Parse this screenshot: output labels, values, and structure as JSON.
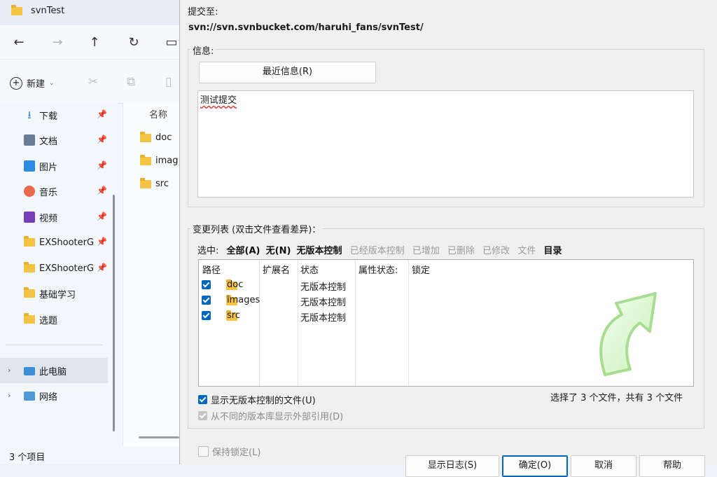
{
  "explorer": {
    "window_title": "svnTest",
    "toolbar": {
      "new_label": "新建"
    },
    "sidebar": [
      {
        "label": "下载",
        "icon": "download-icon",
        "pinned": true
      },
      {
        "label": "文档",
        "icon": "document-icon",
        "pinned": true
      },
      {
        "label": "图片",
        "icon": "pictures-icon",
        "pinned": true
      },
      {
        "label": "音乐",
        "icon": "music-icon",
        "pinned": true
      },
      {
        "label": "视频",
        "icon": "video-icon",
        "pinned": true
      },
      {
        "label": "EXShooterG",
        "icon": "folder-icon",
        "pinned": true
      },
      {
        "label": "EXShooterG",
        "icon": "folder-icon",
        "pinned": true
      },
      {
        "label": "基础学习",
        "icon": "folder-icon",
        "pinned": false
      },
      {
        "label": "选题",
        "icon": "folder-icon",
        "pinned": false
      },
      {
        "label": "此电脑",
        "icon": "computer-icon",
        "pinned": false
      },
      {
        "label": "网络",
        "icon": "network-icon",
        "pinned": false
      }
    ],
    "list_header": "名称",
    "files": [
      "doc",
      "imag",
      "src"
    ],
    "status": "3 个项目"
  },
  "dialog": {
    "commit_to_label": "提交至:",
    "repo_url": "svn://svn.svnbucket.com/haruhi_fans/svnTest/",
    "message_group_label": "信息:",
    "recent_messages_button": "最近信息(R)",
    "message_text": "测试提交",
    "changes_group_label": "变更列表 (双击文件查看差异)：",
    "select_label": "选中:",
    "select_options": [
      {
        "label": "全部(A)",
        "enabled": true
      },
      {
        "label": "无(N)",
        "enabled": true
      },
      {
        "label": "无版本控制",
        "enabled": true
      },
      {
        "label": "已经版本控制",
        "enabled": false
      },
      {
        "label": "已增加",
        "enabled": false
      },
      {
        "label": "已删除",
        "enabled": false
      },
      {
        "label": "已修改",
        "enabled": false
      },
      {
        "label": "文件",
        "enabled": false
      },
      {
        "label": "目录",
        "enabled": true
      }
    ],
    "columns": [
      "路径",
      "扩展名",
      "状态",
      "属性状态:",
      "锁定"
    ],
    "rows": [
      {
        "path": "doc",
        "status": "无版本控制",
        "checked": true
      },
      {
        "path": "images",
        "status": "无版本控制",
        "checked": true
      },
      {
        "path": "src",
        "status": "无版本控制",
        "checked": true
      }
    ],
    "show_unversioned_label": "显示无版本控制的文件(U)",
    "show_externals_label": "从不同的版本库显示外部引用(D)",
    "selection_summary": "选择了 3 个文件，共有 3 个文件",
    "keep_locks_label": "保持锁定(L)",
    "buttons": {
      "show_log": "显示日志(S)",
      "ok": "确定(O)",
      "cancel": "取消",
      "help": "帮助"
    }
  }
}
